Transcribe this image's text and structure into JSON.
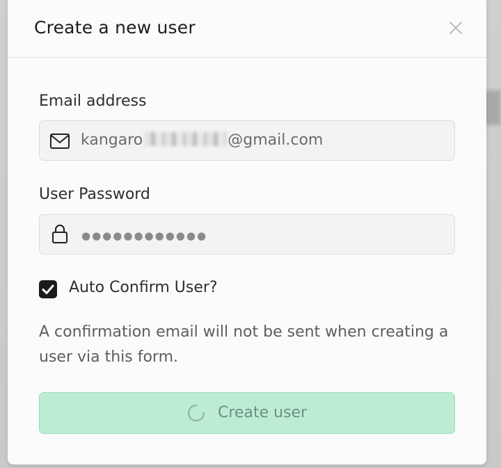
{
  "modal": {
    "title": "Create a new user",
    "close_icon": "close-icon"
  },
  "email": {
    "label": "Email address",
    "value_start": "kangaro",
    "value_end": "@gmail.com",
    "icon": "mail-icon"
  },
  "password": {
    "label": "User Password",
    "masked_value": "●●●●●●●●●●●●",
    "icon": "lock-icon"
  },
  "auto_confirm": {
    "label": "Auto Confirm User?",
    "checked": true
  },
  "note": "A confirmation email will not be sent when creating a user via this form.",
  "submit": {
    "label": "Create user",
    "loading": true
  },
  "colors": {
    "submit_background": "#bdecd5",
    "submit_border": "#9fdcbd",
    "checkbox_fill": "#1a1a1a"
  }
}
